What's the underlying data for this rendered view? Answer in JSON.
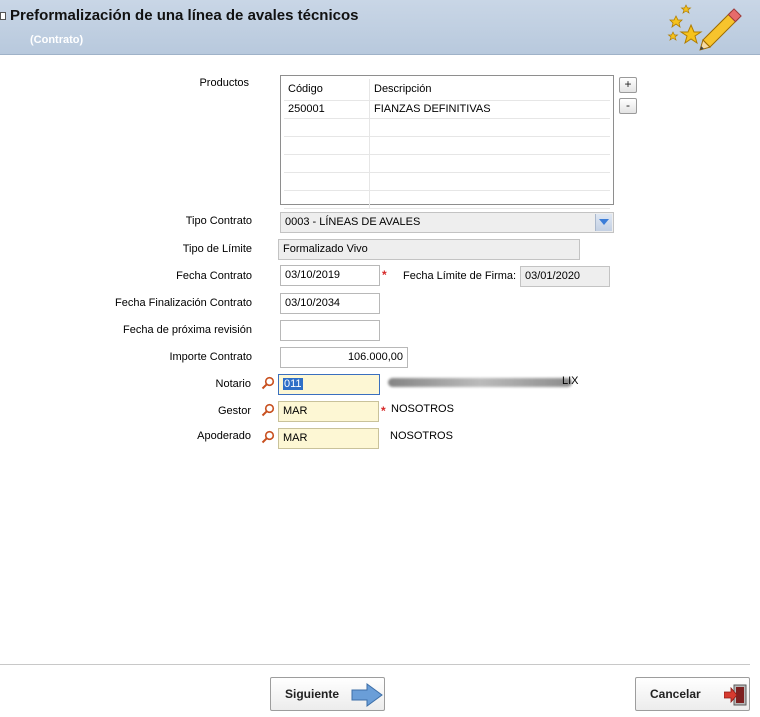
{
  "header": {
    "title": "Preformalización de una línea de avales técnicos",
    "subtitle": "(Contrato)"
  },
  "productos": {
    "label": "Productos",
    "columns": [
      "Código",
      "Descripción"
    ],
    "rows": [
      {
        "codigo": "250001",
        "descripcion": "FIANZAS DEFINITIVAS"
      }
    ],
    "add_label": "+",
    "remove_label": "-"
  },
  "form": {
    "tipo_contrato": {
      "label": "Tipo Contrato",
      "value": "0003 - LÍNEAS DE AVALES"
    },
    "tipo_limite": {
      "label": "Tipo de Límite",
      "value": "Formalizado Vivo"
    },
    "fecha_contrato": {
      "label": "Fecha Contrato",
      "value": "03/10/2019",
      "required": "*"
    },
    "fecha_limite_firma": {
      "label": "Fecha Límite de Firma:",
      "value": "03/01/2020"
    },
    "fecha_finalizacion": {
      "label": "Fecha Finalización Contrato",
      "value": "03/10/2034"
    },
    "fecha_revision": {
      "label": "Fecha de próxima revisión",
      "value": ""
    },
    "importe": {
      "label": "Importe Contrato",
      "value": "106.000,00"
    },
    "notario": {
      "label": "Notario",
      "value": "011",
      "name_suffix": "LIX"
    },
    "gestor": {
      "label": "Gestor",
      "value": "MAR",
      "name": "NOSOTROS",
      "required": "*"
    },
    "apoderado": {
      "label": "Apoderado",
      "value": "MAR",
      "name": "NOSOTROS"
    }
  },
  "footer": {
    "next_label": "Siguiente",
    "cancel_label": "Cancelar"
  },
  "colors": {
    "header_bg": "#c0cfe2",
    "required": "#d62828",
    "lookup_field": "#fdf7d4",
    "readonly_field": "#eeeeee",
    "accent_blue": "#3b7dd8"
  }
}
